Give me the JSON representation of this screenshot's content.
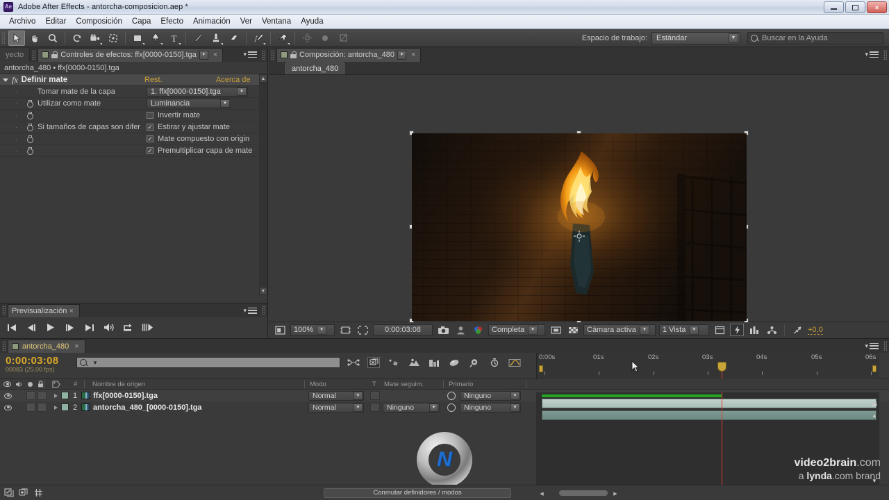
{
  "window": {
    "app_icon": "Ae",
    "title": "Adobe After Effects - antorcha-composicion.aep *",
    "minimize": "minimize-icon",
    "maximize": "maximize-icon",
    "close": "×"
  },
  "menubar": {
    "items": [
      "Archivo",
      "Editar",
      "Composición",
      "Capa",
      "Efecto",
      "Animación",
      "Ver",
      "Ventana",
      "Ayuda"
    ]
  },
  "toolbar": {
    "tools": [
      {
        "name": "selection-tool",
        "glyph": "➤",
        "active": true
      },
      {
        "name": "hand-tool",
        "glyph": "✋",
        "active": false
      },
      {
        "name": "zoom-tool",
        "glyph": "🔍",
        "active": false
      },
      {
        "name": "rotation-tool",
        "glyph": "↻",
        "active": false
      },
      {
        "name": "camera-tool",
        "glyph": "🎥",
        "active": false
      },
      {
        "name": "pan-behind-tool",
        "glyph": "✥",
        "active": false
      },
      {
        "name": "shape-tool",
        "glyph": "▢",
        "active": false
      },
      {
        "name": "pen-tool",
        "glyph": "✒",
        "active": false
      },
      {
        "name": "text-tool",
        "glyph": "T",
        "active": false
      },
      {
        "name": "brush-tool",
        "glyph": "🖌",
        "active": false
      },
      {
        "name": "clone-stamp-tool",
        "glyph": "⎙",
        "active": false
      },
      {
        "name": "eraser-tool",
        "glyph": "▰",
        "active": false
      },
      {
        "name": "roto-brush-tool",
        "glyph": "🖊",
        "active": false
      },
      {
        "name": "puppet-pin-tool",
        "glyph": "📌",
        "active": false
      }
    ],
    "workspace_label": "Espacio de trabajo:",
    "workspace_value": "Estándar",
    "help_placeholder": "Buscar en la Ayuda"
  },
  "effect_controls": {
    "project_tab": "yecto",
    "tab_title": "Controles de efectos: ffx[0000-0150].tga",
    "close_glyph": "×",
    "breadcrumb": "antorcha_480 • ffx[0000-0150].tga",
    "effect_name": "Definir mate",
    "reset_label": "Rest.",
    "about_label": "Acerca de",
    "properties": [
      {
        "label": "Tomar mate de la capa",
        "type": "dropdown",
        "value": "1. ffx[0000-0150].tga",
        "stopwatch": false
      },
      {
        "label": "Utilizar como mate",
        "type": "dropdown",
        "value": "Luminancia",
        "stopwatch": true
      },
      {
        "label": "",
        "type": "checkbox",
        "value": "Invertir mate",
        "checked": false,
        "stopwatch": true
      },
      {
        "label": "Si tamaños de capas son difer",
        "type": "checkbox",
        "value": "Estirar y ajustar mate",
        "checked": true,
        "stopwatch": true
      },
      {
        "label": "",
        "type": "checkbox",
        "value": "Mate compuesto con origin",
        "checked": true,
        "stopwatch": true
      },
      {
        "label": "",
        "type": "checkbox",
        "value": "Premultiplicar capa de mate",
        "checked": true,
        "stopwatch": true
      }
    ]
  },
  "preview": {
    "tab_title": "Previsualización",
    "close_glyph": "×",
    "buttons": [
      {
        "name": "first-frame-button",
        "glyph": "⏮"
      },
      {
        "name": "previous-frame-button",
        "glyph": "◀|"
      },
      {
        "name": "play-button",
        "glyph": "▶"
      },
      {
        "name": "next-frame-button",
        "glyph": "|▶"
      },
      {
        "name": "last-frame-button",
        "glyph": "⏭"
      },
      {
        "name": "audio-toggle-button",
        "glyph": "🔊"
      },
      {
        "name": "loop-button",
        "glyph": "⟲"
      },
      {
        "name": "ram-preview-button",
        "glyph": "⦀▶"
      }
    ]
  },
  "composition": {
    "tab_title": "Composición: antorcha_480",
    "close_glyph": "×",
    "subtab": "antorcha_480",
    "viewer_bottom": {
      "zoom": "100%",
      "time": "0:00:03:08",
      "resolution": "Completa",
      "camera": "Cámara activa",
      "views": "1 Vista",
      "exposure": "+0,0",
      "icons": [
        {
          "name": "always-preview-icon",
          "glyph": "▣"
        },
        {
          "name": "region-of-interest-icon",
          "glyph": "⊞"
        },
        {
          "name": "grid-guides-icon",
          "glyph": "⬚"
        },
        {
          "name": "snapshot-icon",
          "glyph": "📷"
        },
        {
          "name": "show-snapshot-icon",
          "glyph": "👤"
        },
        {
          "name": "channel-rgb-icon",
          "glyph": "◉"
        },
        {
          "name": "region-toggle-icon",
          "glyph": "▭"
        },
        {
          "name": "transparency-grid-icon",
          "glyph": "▩"
        },
        {
          "name": "timeline-link-icon",
          "glyph": "▤"
        },
        {
          "name": "renderer-fast-icon",
          "glyph": "⚡"
        },
        {
          "name": "3d-view-icon",
          "glyph": "🏛"
        },
        {
          "name": "pixel-aspect-icon",
          "glyph": "⚙"
        },
        {
          "name": "exposure-icon",
          "glyph": "✷"
        }
      ]
    }
  },
  "timeline": {
    "tab_title": "antorcha_480",
    "close_glyph": "×",
    "current_time": "0:00:03:08",
    "current_frame": "00083 (25.00 fps)",
    "search_placeholder": "",
    "switch_icons": [
      {
        "name": "live-update-icon",
        "glyph": "⋈"
      },
      {
        "name": "draft-3d-icon",
        "glyph": "▨"
      },
      {
        "name": "hide-shy-layers-icon",
        "glyph": "✻"
      },
      {
        "name": "frame-blending-icon",
        "glyph": "⛰"
      },
      {
        "name": "motion-blur-icon",
        "glyph": "🏢"
      },
      {
        "name": "brainstorm-icon",
        "glyph": "⬭"
      },
      {
        "name": "auto-keyframe-icon",
        "glyph": "🔍"
      },
      {
        "name": "graph-editor-icon",
        "glyph": "⏱"
      },
      {
        "name": "curve-editor-icon",
        "glyph": "📉"
      }
    ],
    "columns": [
      "Nombre de origen",
      "Modo",
      "T",
      "Mate seguim.",
      "Primario"
    ],
    "av_header_icons": [
      "eye-icon",
      "audio-icon",
      "solo-icon",
      "lock-icon",
      "label-icon",
      "#"
    ],
    "layers": [
      {
        "index": "1",
        "name": "ffx[0000-0150].tga",
        "mode": "Normal",
        "track_matte": "",
        "parent": "Ninguno",
        "selected": true
      },
      {
        "index": "2",
        "name": "antorcha_480_[0000-0150].tga",
        "mode": "Normal",
        "track_matte": "Ninguno",
        "parent": "Ninguno",
        "selected": false
      }
    ],
    "ruler_labels": [
      "0:00s",
      "01s",
      "02s",
      "03s",
      "04s",
      "05s",
      "06s"
    ],
    "bottom_toggle": "Conmutar definidores / modos",
    "bottom_icons": [
      {
        "name": "toggle-switches-modes-icon",
        "glyph": "▣"
      },
      {
        "name": "comp-flowchart-icon",
        "glyph": "⧉"
      },
      {
        "name": "graph-editor-toggle-icon",
        "glyph": "⑆"
      }
    ]
  },
  "watermark": {
    "line1_bold": "video2brain",
    "line1_rest": ".com",
    "line2_pre": "a ",
    "line2_bold": "lynda",
    "line2_rest": ".com brand",
    "logo_letter": "N"
  }
}
